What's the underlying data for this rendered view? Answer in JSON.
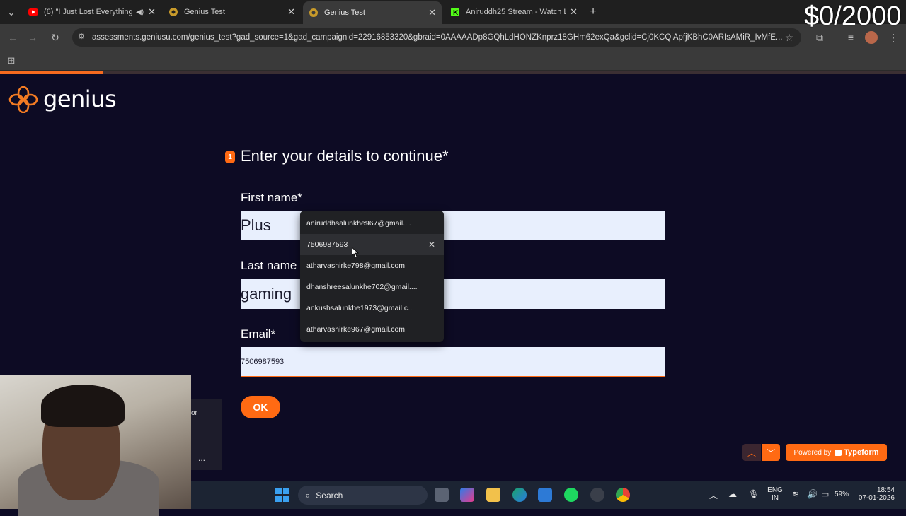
{
  "browser": {
    "tabs": [
      {
        "label": "(6) \"I Just Lost Everything\" -",
        "favicon": "youtube-icon"
      },
      {
        "label": "Genius Test",
        "favicon": "genius-icon"
      },
      {
        "label": "Genius Test",
        "favicon": "genius-icon",
        "active": true
      },
      {
        "label": "Aniruddh25 Stream - Watch Liv",
        "favicon": "kick-icon"
      }
    ],
    "url": "assessments.geniusu.com/genius_test?gad_source=1&gad_campaignid=22916853320&gbraid=0AAAAADp8GQhLdHONZKnprz18GHm62exQa&gclid=Cj0KCQiApfjKBhC0ARIsAMiR_IvMfE..."
  },
  "overlay": {
    "counter": "$0/2000"
  },
  "page": {
    "logo_text": "genius",
    "question_number": "1",
    "question_title": "Enter your details to continue*",
    "first_name": {
      "label": "First name*",
      "value": "Plus"
    },
    "last_name": {
      "label": "Last name",
      "value": "gaming"
    },
    "email": {
      "label": "Email*",
      "value": "7506987593"
    },
    "ok_label": "OK",
    "progress": 0.114,
    "powered_by": "Powered by",
    "powered_brand": "Typeform"
  },
  "autofill": {
    "items": [
      "aniruddhsalunkhe967@gmail....",
      "7506987593",
      "atharvashirke798@gmail.com",
      "dhanshreesalunkhe702@gmail....",
      "ankushsalunkhe1973@gmail.c...",
      "atharvashirke967@gmail.com"
    ]
  },
  "webcam_side": {
    "text": "or",
    "more": "..."
  },
  "taskbar": {
    "search": "Search",
    "lang_top": "ENG",
    "lang_bottom": "IN",
    "battery": "59%",
    "time": "18:54",
    "date": "07-01-2026"
  }
}
